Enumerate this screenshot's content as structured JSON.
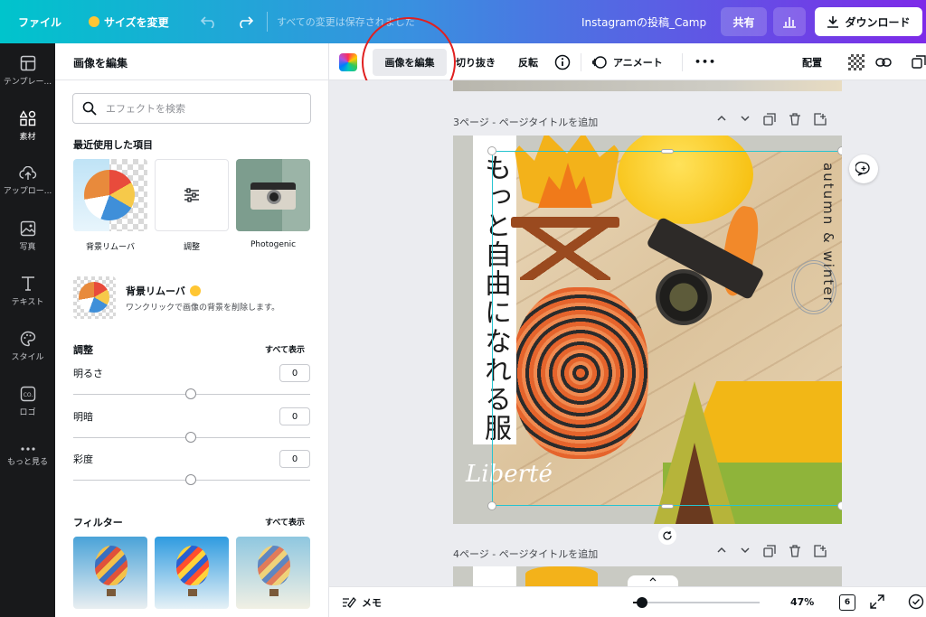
{
  "topbar": {
    "file": "ファイル",
    "resize": "サイズを変更",
    "saved": "すべての変更は保存されました",
    "doc_title": "Instagramの投稿_Camp",
    "share": "共有",
    "download": "ダウンロード"
  },
  "rail": {
    "items": [
      {
        "label": "テンプレー..."
      },
      {
        "label": "素材"
      },
      {
        "label": "アップロー..."
      },
      {
        "label": "写真"
      },
      {
        "label": "テキスト"
      },
      {
        "label": "スタイル"
      },
      {
        "label": "ロゴ"
      },
      {
        "label": "もっと見る"
      }
    ]
  },
  "panel": {
    "title": "画像を編集",
    "search_placeholder": "エフェクトを検索",
    "recent_title": "最近使用した項目",
    "recent": [
      {
        "label": "背景リムーバ"
      },
      {
        "label": "調整"
      },
      {
        "label": "Photogenic"
      }
    ],
    "bg_remover": {
      "title": "背景リムーバ",
      "desc": "ワンクリックで画像の背景を削除します。"
    },
    "adjust": {
      "title": "調整",
      "show_all": "すべて表示",
      "rows": [
        {
          "label": "明るさ",
          "value": "0"
        },
        {
          "label": "明暗",
          "value": "0"
        },
        {
          "label": "彩度",
          "value": "0"
        }
      ]
    },
    "filters": {
      "title": "フィルター",
      "show_all": "すべて表示"
    }
  },
  "toolbar": {
    "edit_image": "画像を編集",
    "crop": "切り抜き",
    "flip": "反転",
    "animate": "アニメート",
    "more": "•••",
    "position": "配置"
  },
  "canvas": {
    "page3_header": "3ページ - ページタイトルを追加",
    "page4_header": "4ページ - ページタイトルを追加",
    "vertical_text": "もっと自由になれる服",
    "side_text": "autumn & winter",
    "script_text": "Liberté"
  },
  "bottom": {
    "memo": "メモ",
    "zoom": "47%",
    "page_count": "6"
  },
  "colors": {
    "accent": "#8b3dff",
    "highlight_circle": "#e02020",
    "selection": "#27c4d0"
  }
}
